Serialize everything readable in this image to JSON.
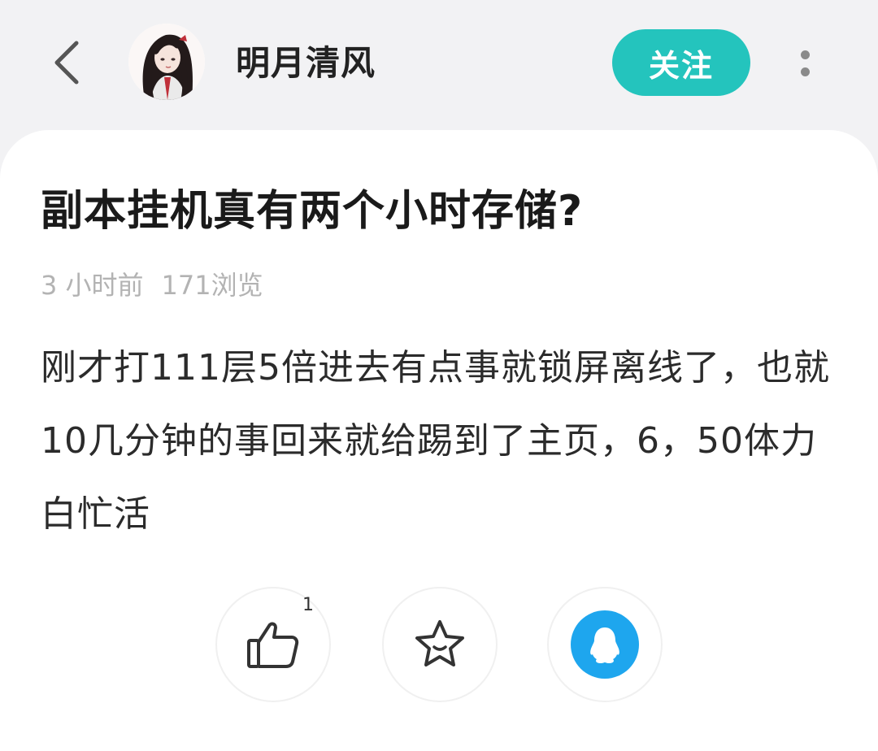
{
  "header": {
    "author_name": "明月清风",
    "follow_label": "关注",
    "icons": {
      "back": "chevron-left-icon",
      "more": "more-vertical-icon"
    },
    "colors": {
      "follow_bg": "#24c4bd"
    }
  },
  "post": {
    "title": "副本挂机真有两个小时存储?",
    "time_ago": "3 小时前",
    "views": "171浏览",
    "body": "刚才打111层5倍进去有点事就锁屏离线了，也就10几分钟的事回来就给踢到了主页，6，50体力白忙活"
  },
  "actions": {
    "like_count": "1",
    "icons": {
      "like": "thumbs-up-icon",
      "favorite": "star-icon",
      "share": "qq-penguin-icon"
    },
    "colors": {
      "qq": "#1ea6ee"
    }
  }
}
